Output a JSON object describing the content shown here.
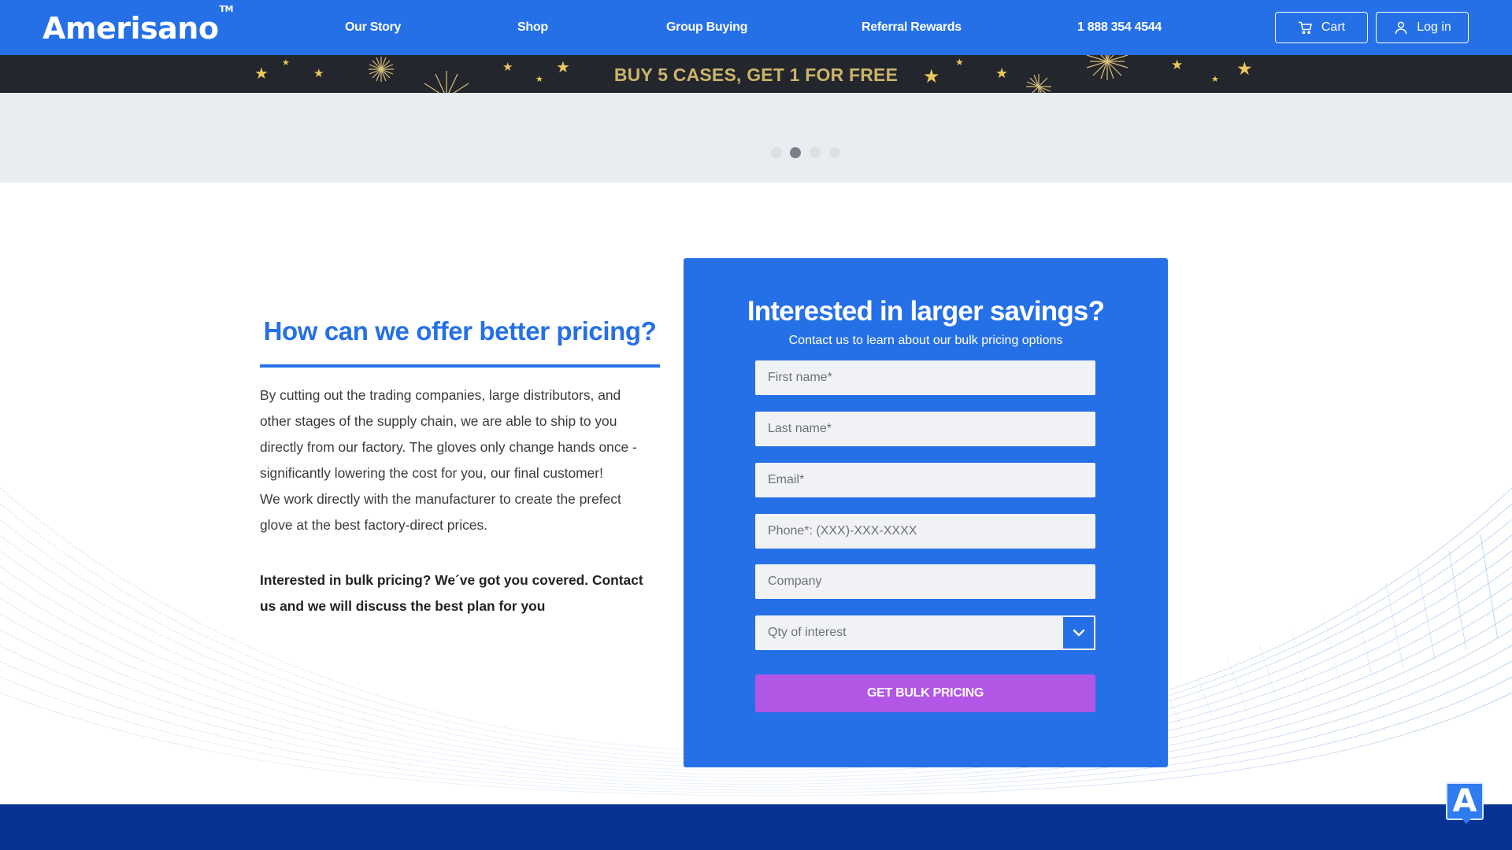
{
  "header": {
    "logo": "Amerisano",
    "logo_tm": "TM",
    "nav": [
      "Our Story",
      "Shop",
      "Group Buying",
      "Referral Rewards",
      "1 888 354 4544"
    ],
    "cart_label": "Cart",
    "login_label": "Log in"
  },
  "promo": {
    "text": "BUY 5 CASES, GET 1 FOR FREE"
  },
  "slider": {
    "slide_count": 4,
    "active_slide": 2
  },
  "info": {
    "title": "How can we offer better pricing?",
    "paragraphs": [
      "By cutting out the trading companies, large distributors, and other stages of the supply chain, we are able to ship to you directly from our factory. The gloves only change hands once - significantly lowering the cost for you, our final customer!",
      "We work directly with the manufacturer to create the prefect glove at the best factory-direct prices."
    ],
    "bold_text": "Interested in bulk pricing? We´ve got you covered. Contact us and we will discuss the best plan for you"
  },
  "form": {
    "title": "Interested in larger savings?",
    "subtitle": "Contact us to learn about our bulk pricing options",
    "first_name_placeholder": "First name*",
    "last_name_placeholder": "Last name*",
    "email_placeholder": "Email*",
    "phone_placeholder": "Phone*: (XXX)-XXX-XXXX",
    "company_placeholder": "Company",
    "qty_label": "Qty of interest",
    "submit_label": "GET BULK PRICING"
  },
  "widget": {
    "letter": "A"
  },
  "colors": {
    "brand_blue": "#2570e6",
    "promo_gold": "#cbb46a",
    "cta_purple": "#b256e6",
    "footer_navy": "#083194"
  }
}
